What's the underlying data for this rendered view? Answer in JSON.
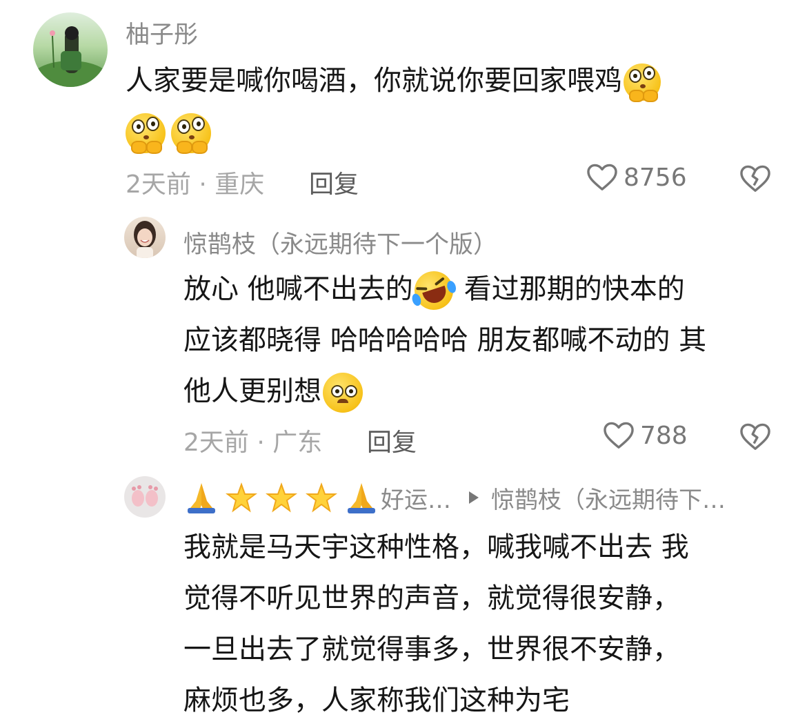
{
  "comments": [
    {
      "username": "柚子彤",
      "text_lines": [
        "人家要是喊你喝酒，你就说你要回家喂鸡"
      ],
      "time_location": "2天前 · 重庆",
      "reply_label": "回复",
      "likes": "8756",
      "emojis": [
        "thinking-shy-emoji",
        "thinking-shy-emoji",
        "thinking-shy-emoji"
      ]
    },
    {
      "username": "惊鹊枝（永远期待下一个版）",
      "text_line1_a": "放心 他喊不出去的",
      "text_line1_b": "看过那期的快本的",
      "text_line2": "应该都晓得 哈哈哈哈哈 朋友都喊不动的 其",
      "text_line3": "他人更别想",
      "time_location": "2天前 · 广东",
      "reply_label": "回复",
      "likes": "788",
      "emojis": [
        "laughing-tears-emoji",
        "pleading-emoji"
      ]
    },
    {
      "username_prefix": "好运…",
      "reply_to": "惊鹊枝（永远期待下…",
      "name_emojis": [
        "folded-hands",
        "star",
        "star",
        "star",
        "folded-hands"
      ],
      "text_lines": [
        "我就是马天宇这种性格，喊我喊不出去 我",
        "觉得不听见世界的声音，就觉得很安静，",
        "一旦出去了就觉得事多，世界很不安静，",
        "麻烦也多，人家称我们这种为宅"
      ]
    }
  ],
  "colors": {
    "meta_gray": "#a6a6a6",
    "name_gray": "#8a8a8a",
    "text": "#161616"
  }
}
